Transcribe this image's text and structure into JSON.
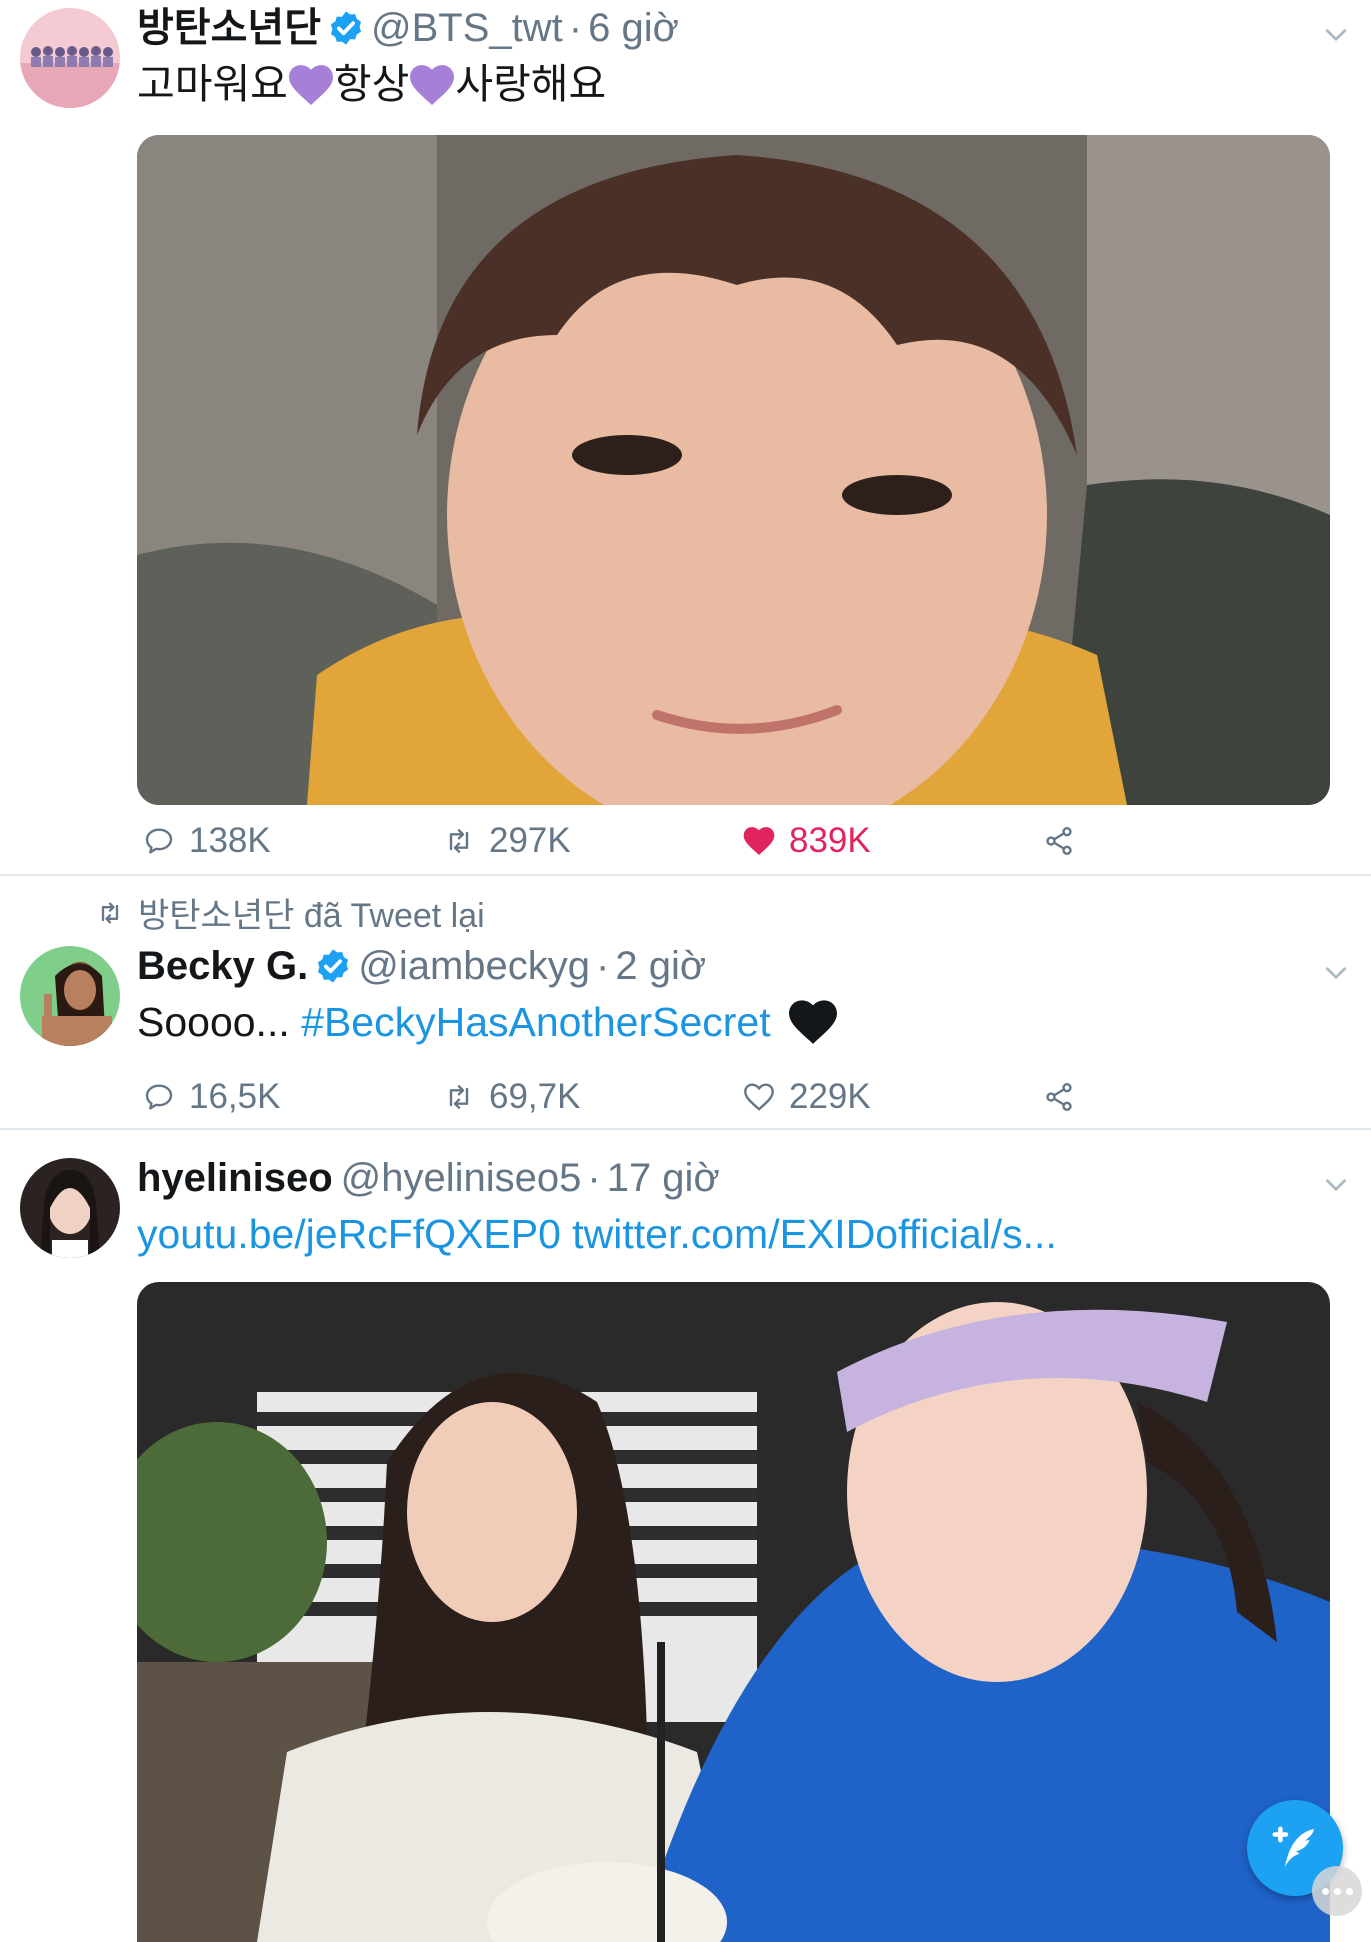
{
  "tweets": [
    {
      "name": "방탄소년단",
      "handle": "@BTS_twt",
      "dot": "·",
      "time": "6 giờ",
      "text_parts": [
        "고마워요",
        "항상",
        "사랑해요"
      ],
      "replies": "138K",
      "retweets": "297K",
      "likes": "839K"
    },
    {
      "retweet_context": "방탄소년단 đã Tweet lại",
      "name": "Becky G.",
      "handle": "@iambeckyg",
      "dot": "·",
      "time": "2 giờ",
      "text": "Soooo...",
      "hashtag": "#BeckyHasAnotherSecret",
      "replies": "16,5K",
      "retweets": "69,7K",
      "likes": "229K"
    },
    {
      "name": "hyeliniseo",
      "handle": "@hyeliniseo5",
      "dot": "·",
      "time": "17 giờ",
      "link1": "youtu.be/jeRcFfQXEP0",
      "link2": "twitter.com/EXIDofficial/s..."
    }
  ],
  "colors": {
    "accent": "#1da1f2",
    "link": "#1b95e0",
    "like": "#e0245e",
    "muted": "#657786",
    "purple_heart": "#a67fd8"
  },
  "icons": [
    "verified-badge-icon",
    "chevron-down-icon",
    "reply-icon",
    "retweet-icon",
    "heart-icon",
    "share-icon",
    "compose-tweet-icon",
    "more-options-icon"
  ]
}
